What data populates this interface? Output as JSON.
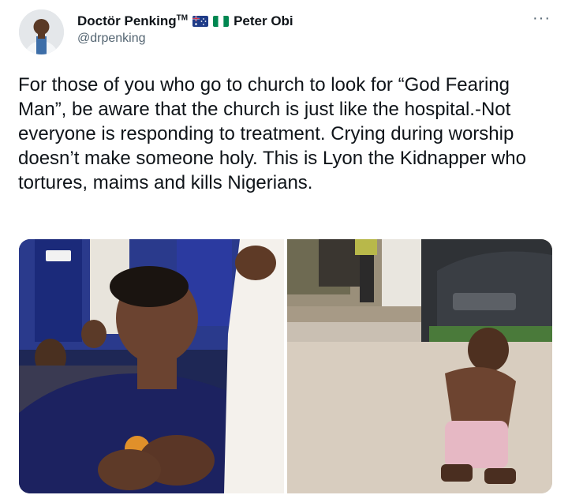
{
  "tweet": {
    "display_name": "Doctör Penking",
    "tm": "TM",
    "name_suffix": "Peter Obi",
    "handle": "@drpenking",
    "more_glyph": "···",
    "text": "For those of you who go to church to look for “God Fearing Man”, be aware that the church is just like the hospital.-Not everyone is responding to treatment. Crying during worship doesn’t make someone holy. This is Lyon the Kidnapper who tortures, maims and kills Nigerians.",
    "icons": {
      "avatar": "avatar-photo",
      "flag_1": "australia-flag-icon",
      "flag_2": "nigeria-flag-icon",
      "more": "more-options-icon"
    },
    "media": [
      {
        "description_name": "church-worship-photo"
      },
      {
        "description_name": "kneeling-man-photo"
      }
    ]
  },
  "colors": {
    "text": "#0f1419",
    "secondary": "#536471",
    "background": "#ffffff"
  }
}
